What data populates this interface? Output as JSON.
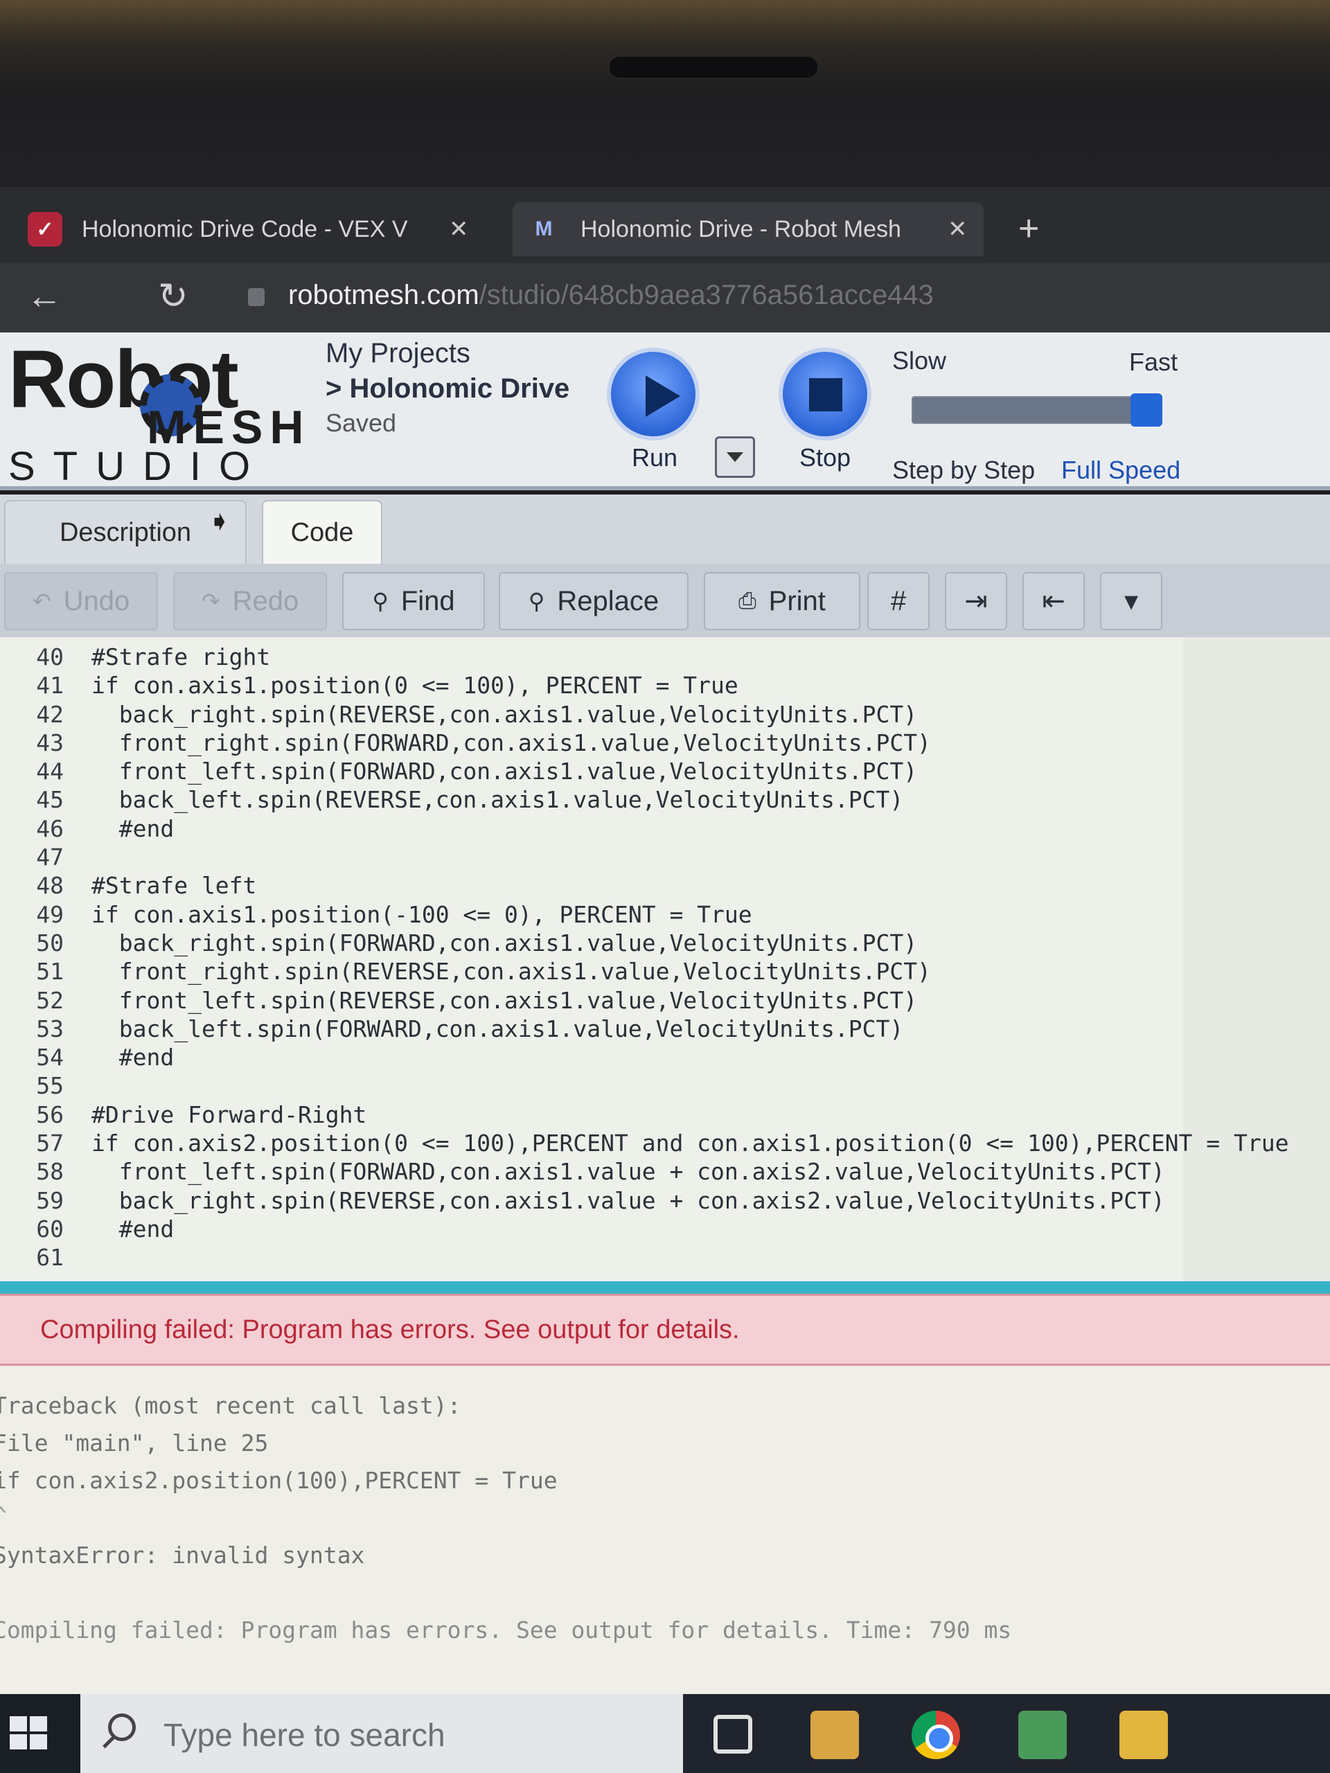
{
  "browser": {
    "tabs": [
      {
        "title": "Holonomic Drive Code - VEX V",
        "icon": "vex-favicon"
      },
      {
        "title": "Holonomic Drive - Robot Mesh",
        "icon": "robotmesh-favicon"
      }
    ],
    "tab_close_glyph": "✕",
    "new_tab_glyph": "+",
    "url_host": "robotmesh.com",
    "url_path": "/studio/648cb9aea3776a561acce443"
  },
  "app": {
    "logo": {
      "robot": "Robot",
      "mesh": "MESH",
      "studio": "STUDIO"
    },
    "breadcrumb": {
      "root": "My Projects",
      "project": "> Holonomic Drive",
      "status": "Saved"
    },
    "run_label": "Run",
    "stop_label": "Stop",
    "speed": {
      "slow_label": "Slow",
      "fast_label": "Fast",
      "step_label": "Step by Step",
      "full_label": "Full Speed",
      "level_percent": 100
    }
  },
  "tabs": {
    "description": "Description",
    "code": "Code",
    "active": "Code"
  },
  "toolbar": {
    "undo": "Undo",
    "redo": "Redo",
    "find": "Find",
    "replace": "Replace",
    "print": "Print",
    "hash": "#"
  },
  "editor": {
    "line_numbers": [
      "40",
      "41",
      "42",
      "43",
      "44",
      "45",
      "46",
      "47",
      "48",
      "49",
      "50",
      "51",
      "52",
      "53",
      "54",
      "55",
      "56",
      "57",
      "58",
      "59",
      "60",
      "61"
    ],
    "lines": [
      "#Strafe right",
      "if con.axis1.position(0 <= 100), PERCENT = True",
      "  back_right.spin(REVERSE,con.axis1.value,VelocityUnits.PCT)",
      "  front_right.spin(FORWARD,con.axis1.value,VelocityUnits.PCT)",
      "  front_left.spin(FORWARD,con.axis1.value,VelocityUnits.PCT)",
      "  back_left.spin(REVERSE,con.axis1.value,VelocityUnits.PCT)",
      "  #end",
      "",
      "#Strafe left",
      "if con.axis1.position(-100 <= 0), PERCENT = True",
      "  back_right.spin(FORWARD,con.axis1.value,VelocityUnits.PCT)",
      "  front_right.spin(REVERSE,con.axis1.value,VelocityUnits.PCT)",
      "  front_left.spin(REVERSE,con.axis1.value,VelocityUnits.PCT)",
      "  back_left.spin(FORWARD,con.axis1.value,VelocityUnits.PCT)",
      "  #end",
      "",
      "#Drive Forward-Right",
      "if con.axis2.position(0 <= 100),PERCENT and con.axis1.position(0 <= 100),PERCENT = True",
      "  front_left.spin(FORWARD,con.axis1.value + con.axis2.value,VelocityUnits.PCT)",
      "  back_right.spin(REVERSE,con.axis1.value + con.axis2.value,VelocityUnits.PCT)",
      "  #end",
      ""
    ]
  },
  "error_banner": "Compiling failed: Program has errors. See output for details.",
  "output": [
    "Traceback (most recent call last):",
    "File \"main\", line 25",
    "if con.axis2.position(100),PERCENT = True",
    "^",
    "SyntaxError: invalid syntax",
    "Compiling failed: Program has errors. See output for details. Time: 790 ms"
  ],
  "taskbar": {
    "search_placeholder": "Type here to search"
  }
}
